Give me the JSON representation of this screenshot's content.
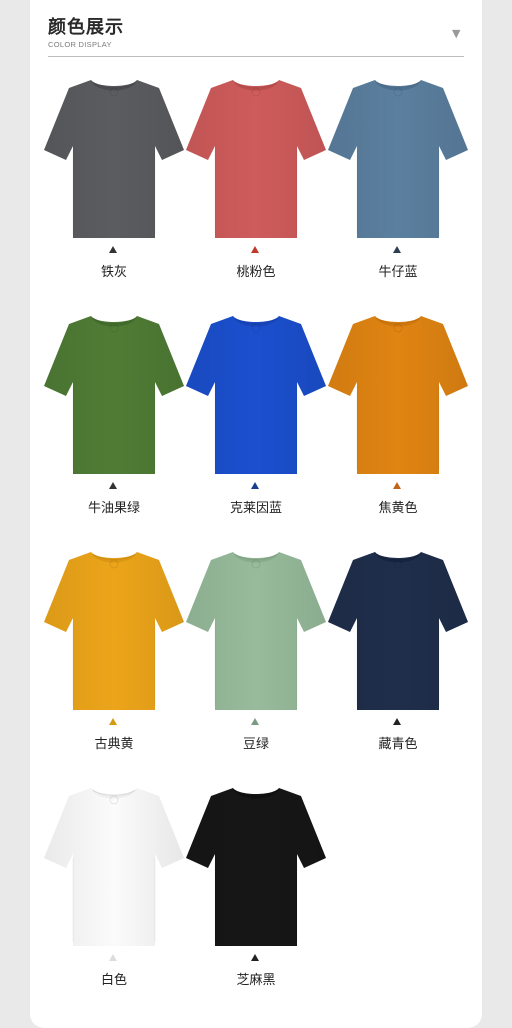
{
  "header": {
    "title": "颜色展示",
    "subtitle": "COLOR DISPLAY",
    "dropdown_icon": "triangle-down-icon"
  },
  "colors": [
    {
      "label": "铁灰",
      "color": "#5b5c5f",
      "collar": "#4a4b4e",
      "marker": "#333333"
    },
    {
      "label": "桃粉色",
      "color": "#cf5b5b",
      "collar": "#bb4c4c",
      "marker": "#c0392b"
    },
    {
      "label": "牛仔蓝",
      "color": "#5b7f9f",
      "collar": "#4d6f8e",
      "marker": "#2c3e50"
    },
    {
      "label": "牛油果绿",
      "color": "#4f7c35",
      "collar": "#436c2c",
      "marker": "#333333"
    },
    {
      "label": "克莱因蓝",
      "color": "#1b4fce",
      "collar": "#1745b9",
      "marker": "#1a3f8f"
    },
    {
      "label": "焦黄色",
      "color": "#e08412",
      "collar": "#cf760c",
      "marker": "#c0651a"
    },
    {
      "label": "古典黄",
      "color": "#eca51a",
      "collar": "#dc9712",
      "marker": "#d49a12"
    },
    {
      "label": "豆绿",
      "color": "#97bb9b",
      "collar": "#87ab8c",
      "marker": "#7b9a82"
    },
    {
      "label": "藏青色",
      "color": "#1f2e4b",
      "collar": "#172440",
      "marker": "#222222"
    },
    {
      "label": "白色",
      "color": "#fbfbfb",
      "collar": "#eeeeee",
      "marker": "#dddddd"
    },
    {
      "label": "芝麻黑",
      "color": "#161616",
      "collar": "#0f0f0f",
      "marker": "#222222"
    }
  ]
}
